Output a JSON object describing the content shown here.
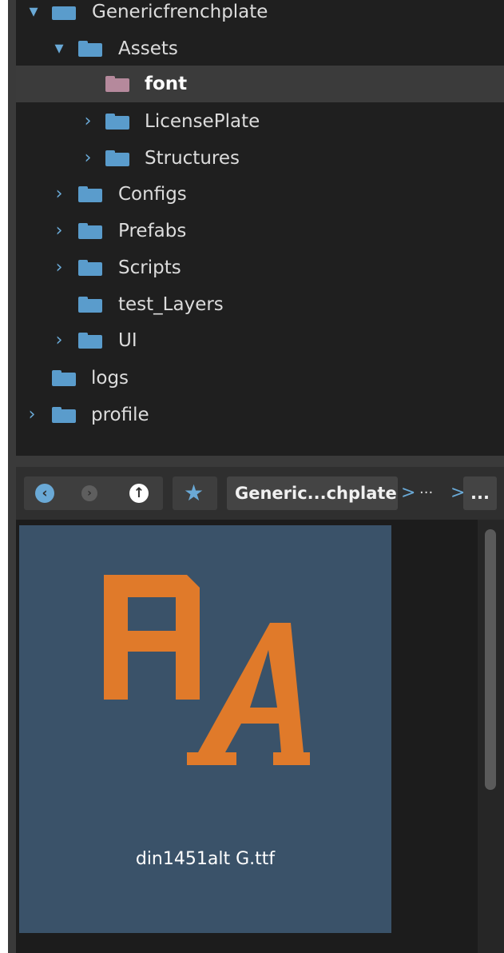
{
  "tree": {
    "items": [
      {
        "label": "Genericfrenchplate",
        "chevron": "expanded",
        "icon": "folder-open-icon"
      },
      {
        "label": "Assets",
        "chevron": "expanded",
        "icon": "folder-open-icon"
      },
      {
        "label": "font",
        "chevron": "none",
        "icon": "folder-icon",
        "selected": true
      },
      {
        "label": "LicensePlate",
        "chevron": "collapsed",
        "icon": "folder-icon"
      },
      {
        "label": "Structures",
        "chevron": "collapsed",
        "icon": "folder-icon"
      },
      {
        "label": "Configs",
        "chevron": "collapsed",
        "icon": "folder-icon"
      },
      {
        "label": "Prefabs",
        "chevron": "collapsed",
        "icon": "folder-icon"
      },
      {
        "label": "Scripts",
        "chevron": "collapsed",
        "icon": "folder-icon"
      },
      {
        "label": "test_Layers",
        "chevron": "none",
        "icon": "folder-icon"
      },
      {
        "label": "UI",
        "chevron": "collapsed",
        "icon": "folder-icon"
      },
      {
        "label": "logs",
        "chevron": "none",
        "icon": "folder-icon"
      },
      {
        "label": "profile",
        "chevron": "collapsed",
        "icon": "folder-icon"
      }
    ]
  },
  "toolbar": {
    "back_icon": "back-arrow-icon",
    "forward_icon": "forward-arrow-icon",
    "up_icon": "up-arrow-icon",
    "favorite_icon": "star-icon",
    "breadcrumb_root": "Generic...chplate",
    "breadcrumb_sep": ">",
    "breadcrumb_ellipsis": "···",
    "breadcrumb_more": "..."
  },
  "asset": {
    "name": "din1451alt G.ttf",
    "icon": "font-file-icon"
  },
  "colors": {
    "folder": "#5a9ccc",
    "selected_folder": "#b5899c",
    "accent": "#6aa9d6",
    "font_icon": "#e07a2a",
    "tile": "#3a5269"
  }
}
